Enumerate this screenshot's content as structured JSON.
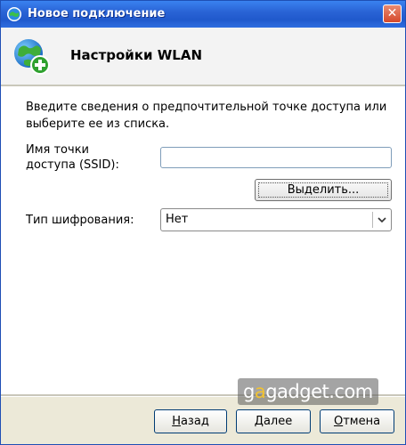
{
  "window": {
    "title": "Новое подключение",
    "close_glyph": "✕"
  },
  "header": {
    "title": "Настройки WLAN",
    "icon": "globe-add-icon"
  },
  "form": {
    "intro": "Введите сведения о предпочтительной точке доступа или выберите ее из списка.",
    "ssid_label_line1": "Имя точки",
    "ssid_label_line2": "доступа (SSID):",
    "ssid_value": "",
    "select_button": "Выделить...",
    "encryption_label": "Тип шифрования:",
    "encryption_value": "Нет"
  },
  "footer": {
    "back_first": "Н",
    "back_rest": "азад",
    "next_first": "Д",
    "next_rest": "алее",
    "cancel_first": "О",
    "cancel_rest": "тмена"
  },
  "watermark": {
    "part1": "g",
    "accent": "a",
    "part2": "gadget.com"
  },
  "colors": {
    "titlebar": "#2a64d6",
    "close": "#d6492b",
    "accent_watermark": "#f2c230"
  }
}
